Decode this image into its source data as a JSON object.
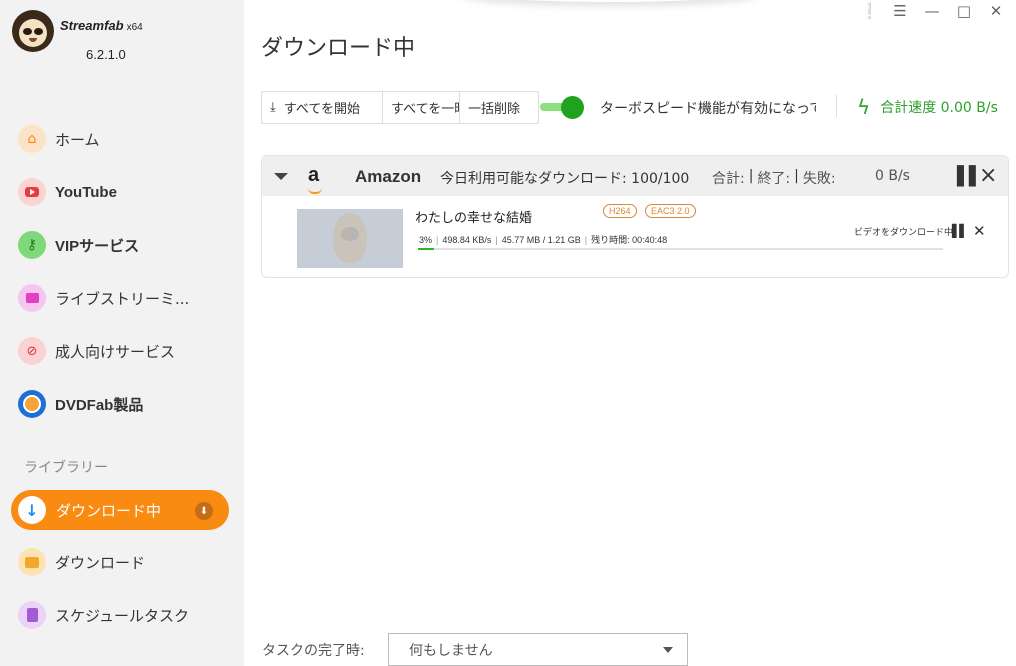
{
  "app": {
    "brand": "Streamfab",
    "arch": "x64",
    "version": "6.2.1.0"
  },
  "window_controls": {
    "skin": "❕",
    "menu": "☰",
    "minimize": "—",
    "maximize": "□",
    "close": "✕"
  },
  "sidebar": {
    "items": [
      {
        "label": "ホーム",
        "icon": "home-icon",
        "color": "#f9a035"
      },
      {
        "label": "YouTube",
        "icon": "youtube-icon",
        "color": "#ee4a4a"
      },
      {
        "label": "VIPサービス",
        "icon": "key-icon",
        "color": "#3cb54a"
      },
      {
        "label": "ライブストリーミ...",
        "icon": "camera-icon",
        "color": "#e84ec8"
      },
      {
        "label": "成人向けサービス",
        "icon": "adult-icon",
        "color": "#ee4a4a"
      },
      {
        "label": "DVDFab製品",
        "icon": "dvdfab-icon",
        "color": "#1e6fd8"
      }
    ],
    "library_label": "ライブラリー",
    "library": [
      {
        "label": "ダウンロード中",
        "icon": "download-icon",
        "active": true
      },
      {
        "label": "ダウンロード",
        "icon": "folder-icon",
        "color": "#f7b83a"
      },
      {
        "label": "スケジュールタスク",
        "icon": "schedule-icon",
        "color": "#b06fd8"
      }
    ]
  },
  "main": {
    "title": "ダウンロード中",
    "toolbar": {
      "start_all": "すべてを開始",
      "pause_all": "すべてを一時停止",
      "delete_all": "一括削除",
      "turbo_label": "ターボスピード機能が有効になっています",
      "total_speed": "合計速度 0.00 B/s"
    },
    "group": {
      "service": "Amazon",
      "quota": "今日利用可能なダウンロード: 100/100",
      "total": "合計:",
      "finished": "終了:",
      "failed": "失敗:",
      "speed": "0 B/s",
      "items": [
        {
          "title": "わたしの幸せな結婚",
          "tags": [
            "H264",
            "EAC3 2.0"
          ],
          "percent": "3%",
          "rate": "498.84 KB/s",
          "size": "45.77 MB / 1.21 GB",
          "remaining": "残り時間: 00:40:48",
          "status": "ビデオをダウンロード中",
          "progress_fraction": 0.03
        }
      ]
    },
    "footer": {
      "label": "タスクの完了時:",
      "select_value": "何もしません"
    }
  }
}
